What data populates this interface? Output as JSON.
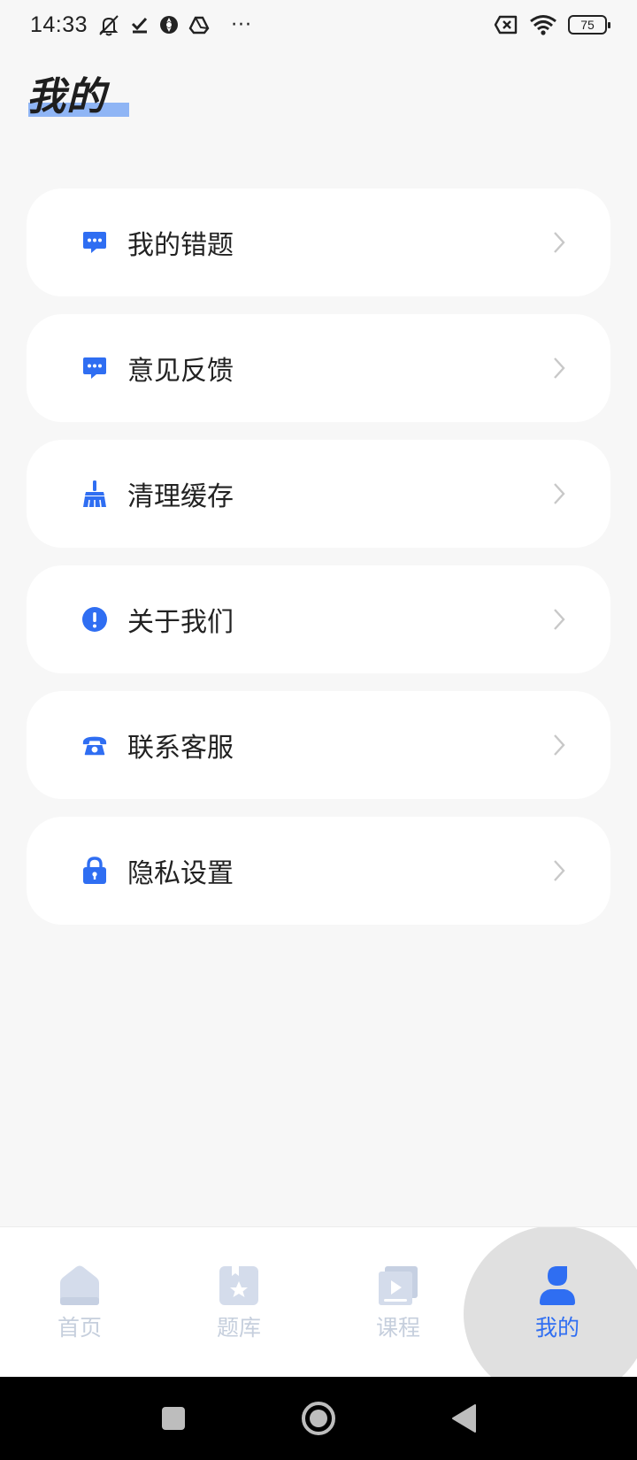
{
  "status_bar": {
    "time": "14:33",
    "ellipsis": "···",
    "battery": "75",
    "icons": [
      "mute-icon",
      "check-icon",
      "aperture-icon",
      "drive-icon",
      "sim-x-icon",
      "wifi-icon",
      "battery-icon"
    ]
  },
  "page": {
    "title": "我的"
  },
  "menu": {
    "items": [
      {
        "label": "我的错题",
        "icon": "chat-bubble-icon"
      },
      {
        "label": "意见反馈",
        "icon": "chat-bubble-icon"
      },
      {
        "label": "清理缓存",
        "icon": "broom-icon"
      },
      {
        "label": "关于我们",
        "icon": "info-icon"
      },
      {
        "label": "联系客服",
        "icon": "phone-icon"
      },
      {
        "label": "隐私设置",
        "icon": "lock-icon"
      }
    ]
  },
  "bottom_nav": {
    "items": [
      {
        "label": "首页",
        "icon": "home-icon",
        "active": false
      },
      {
        "label": "题库",
        "icon": "question-bank-icon",
        "active": false
      },
      {
        "label": "课程",
        "icon": "course-icon",
        "active": false
      },
      {
        "label": "我的",
        "icon": "profile-icon",
        "active": true
      }
    ]
  },
  "colors": {
    "accent": "#2f6ef2",
    "inactive": "#c6cfdd",
    "title_highlight": "#8fb5f5",
    "background": "#f7f7f7"
  }
}
